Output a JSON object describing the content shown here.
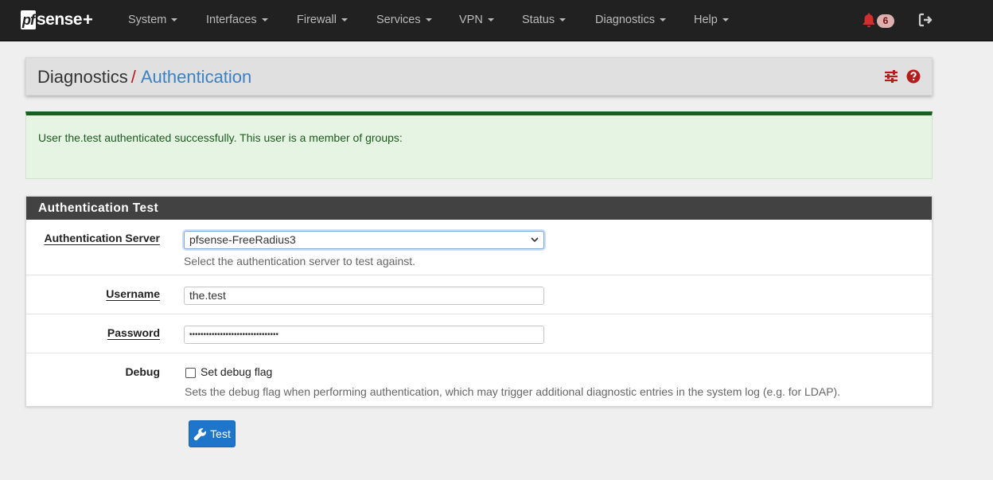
{
  "brand": {
    "pf": "pf",
    "sense": "sense",
    "plus": "+"
  },
  "nav": {
    "items": [
      "System",
      "Interfaces",
      "Firewall",
      "Services",
      "VPN",
      "Status",
      "Diagnostics",
      "Help"
    ],
    "notification_count": "6"
  },
  "breadcrumb": {
    "parent": "Diagnostics",
    "separator": "/",
    "current": "Authentication"
  },
  "alert": {
    "message": "User the.test authenticated successfully. This user is a member of groups:"
  },
  "panel": {
    "title": "Authentication Test",
    "auth_server": {
      "label": "Authentication Server",
      "selected": "pfsense-FreeRadius3",
      "help": "Select the authentication server to test against."
    },
    "username": {
      "label": "Username",
      "value": "the.test"
    },
    "password": {
      "label": "Password",
      "masked_value": "••••••••••••••••••••••••••••••••"
    },
    "debug": {
      "label": "Debug",
      "checkbox_label": "Set debug flag",
      "checked": false,
      "help": "Sets the debug flag when performing authentication, which may trigger additional diagnostic entries in the system log (e.g. for LDAP)."
    }
  },
  "test_button": {
    "label": "Test"
  },
  "colors": {
    "navbar": "#212121",
    "accent_red": "#b71c1c",
    "link_blue": "#3b81c4",
    "success_bg": "#e6f4e3",
    "success_border": "#1b5e20",
    "panel_header": "#424242",
    "button_blue": "#1e75c9"
  },
  "icons": [
    "bell-icon",
    "logout-icon",
    "sliders-icon",
    "help-circle-icon",
    "chevron-down-icon",
    "wrench-icon",
    "caret-down-icon"
  ]
}
